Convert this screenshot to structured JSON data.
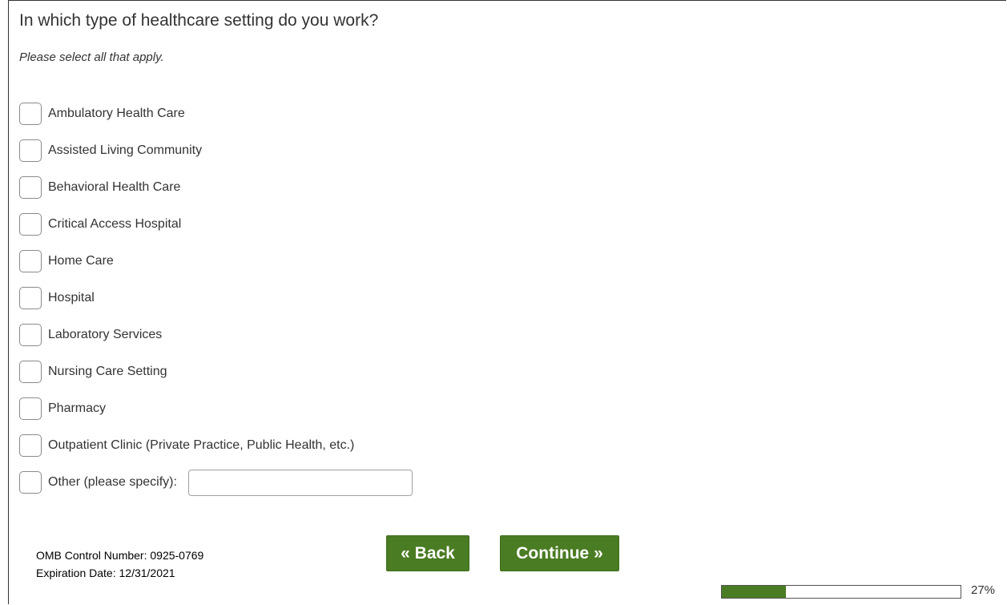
{
  "question": {
    "title": "In which type of healthcare setting do you work?",
    "instruction": "Please select all that apply."
  },
  "options": [
    {
      "label": "Ambulatory Health Care",
      "checked": false
    },
    {
      "label": "Assisted Living Community",
      "checked": false
    },
    {
      "label": "Behavioral Health Care",
      "checked": false
    },
    {
      "label": "Critical Access Hospital",
      "checked": false
    },
    {
      "label": "Home Care",
      "checked": false
    },
    {
      "label": "Hospital",
      "checked": false
    },
    {
      "label": "Laboratory Services",
      "checked": false
    },
    {
      "label": "Nursing Care Setting",
      "checked": false
    },
    {
      "label": "Pharmacy",
      "checked": false
    },
    {
      "label": "Outpatient Clinic (Private Practice, Public Health, etc.)",
      "checked": false
    },
    {
      "label": "Other (please specify):",
      "checked": false
    }
  ],
  "other_input": {
    "value": "",
    "placeholder": ""
  },
  "footer": {
    "omb_control": "OMB Control Number: 0925-0769",
    "expiration": "Expiration Date: 12/31/2021"
  },
  "nav": {
    "back_label": "« Back",
    "continue_label": "Continue »"
  },
  "progress": {
    "percent": 27,
    "label": "27%"
  },
  "colors": {
    "accent": "#4a7c23"
  }
}
